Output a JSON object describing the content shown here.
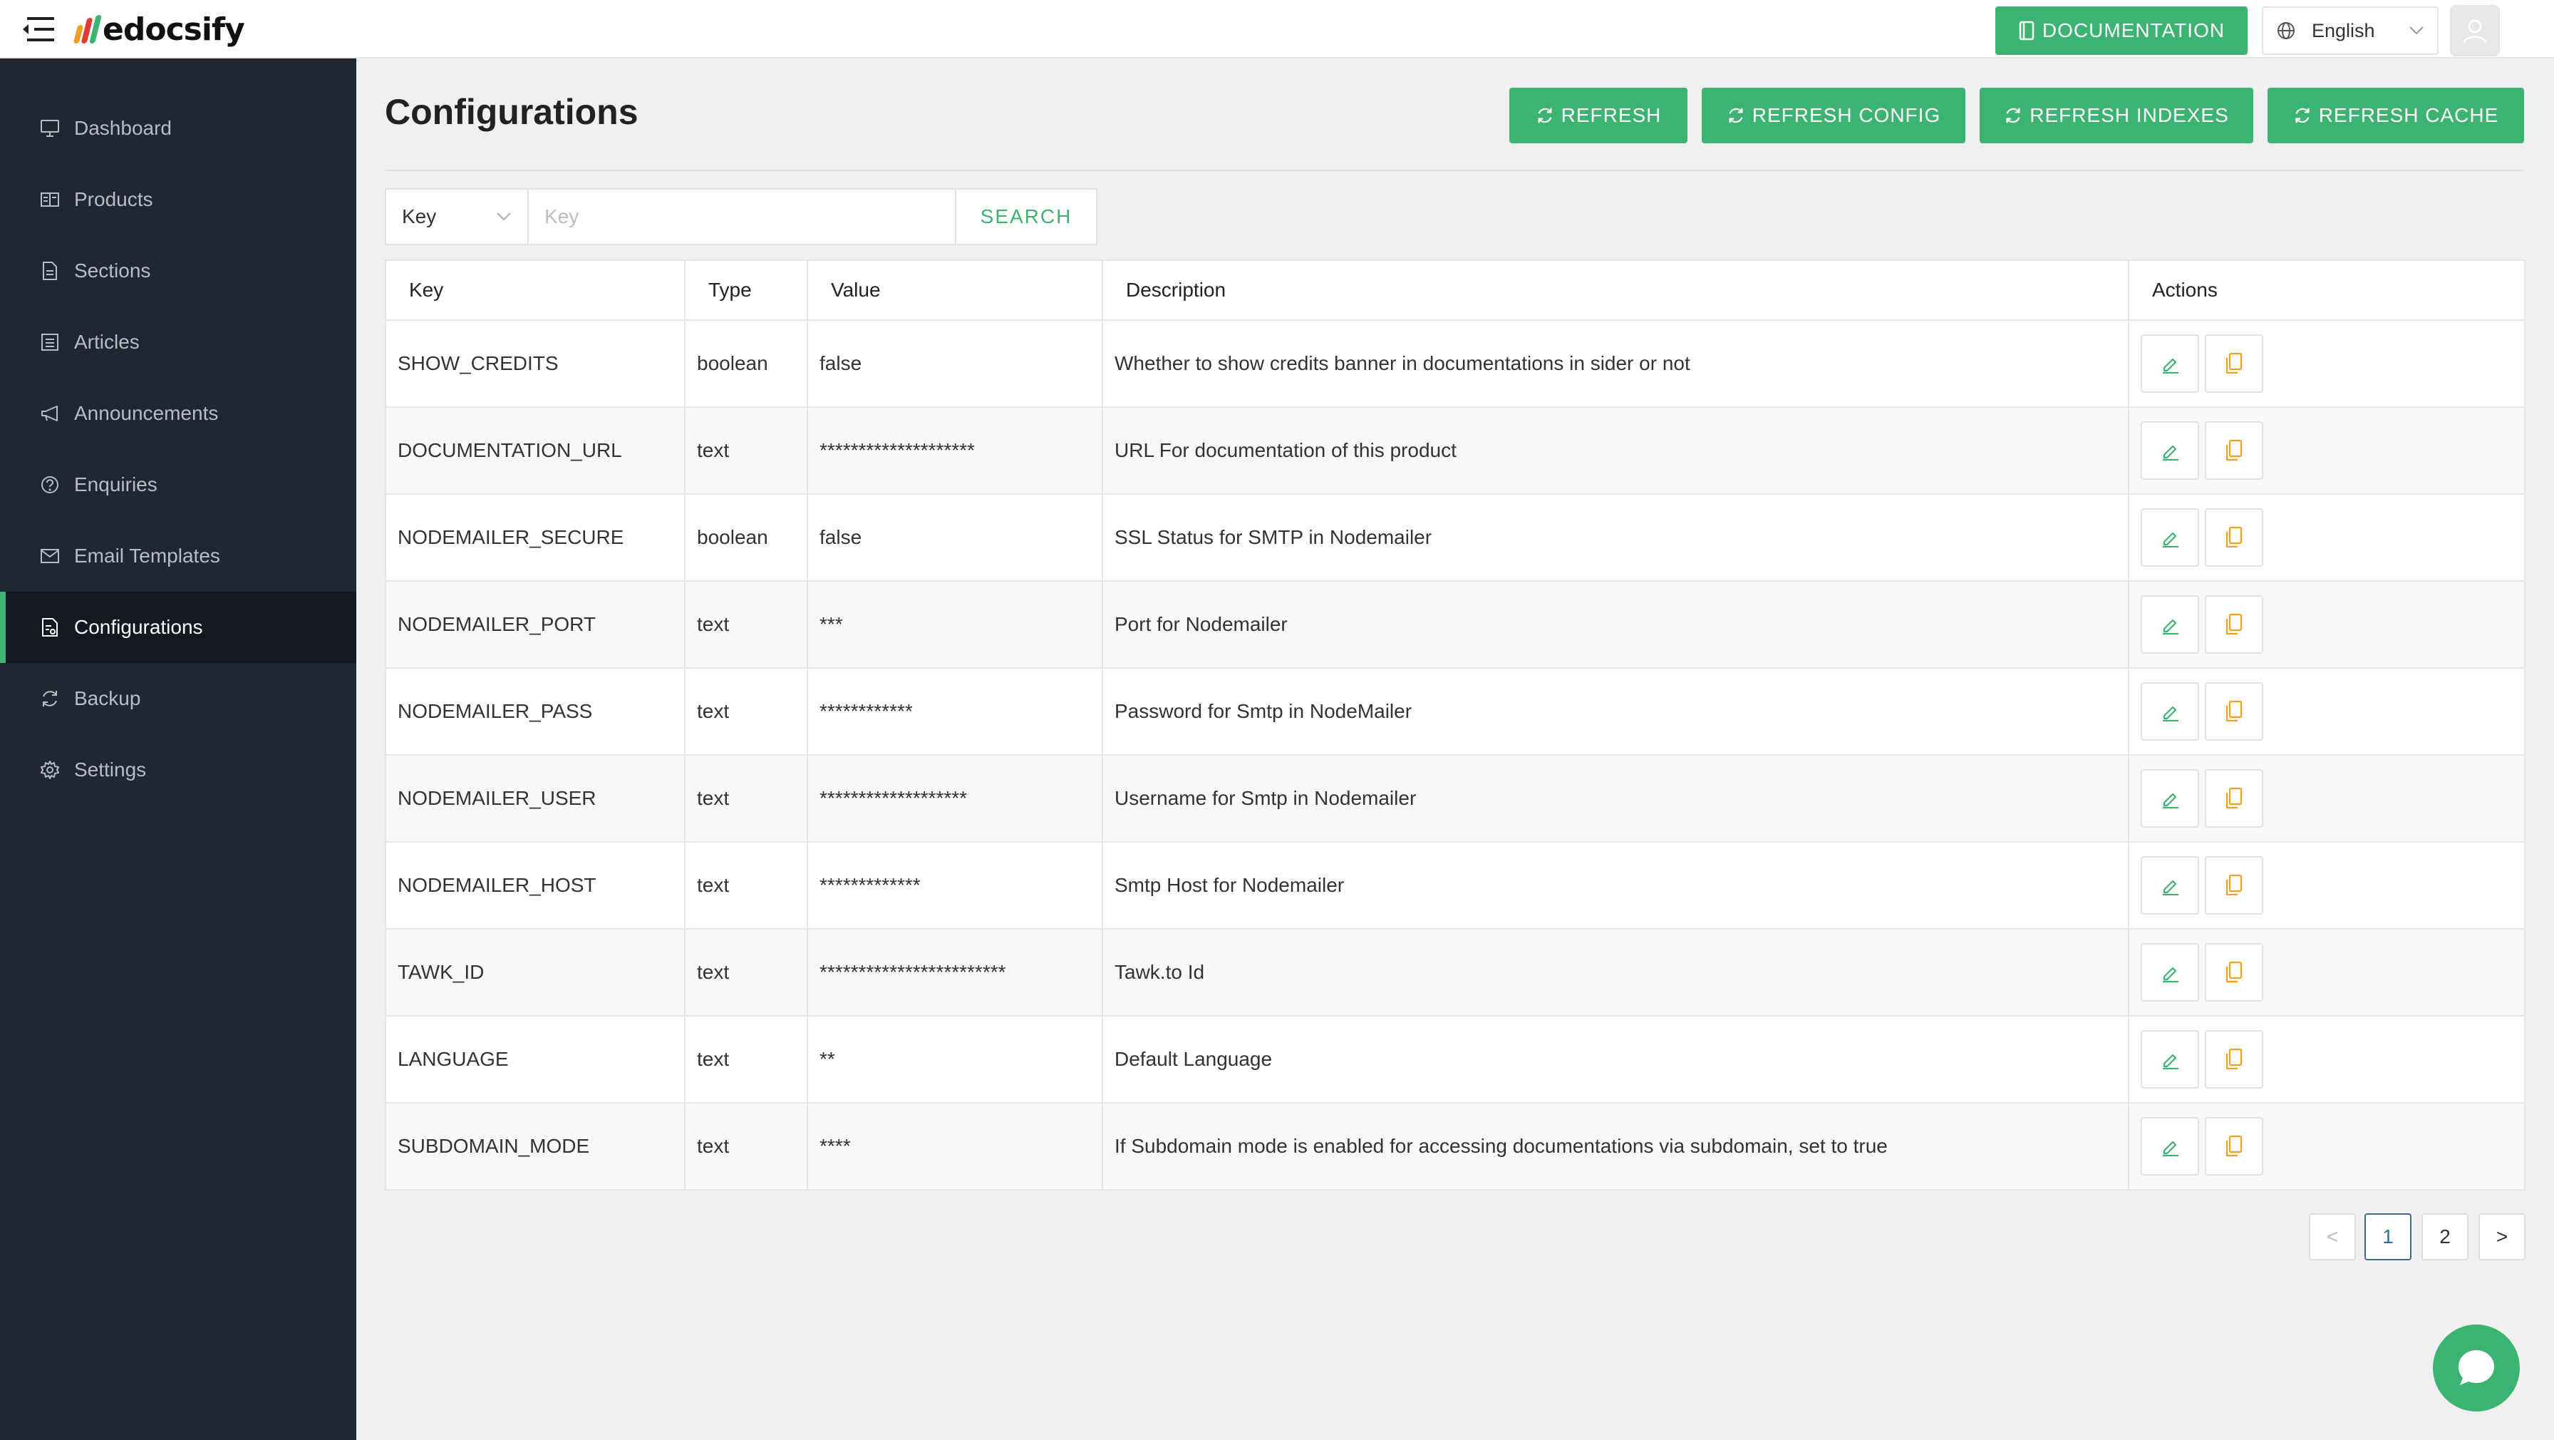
{
  "app": {
    "logo_text": "edocsify",
    "documentation_label": "DOCUMENTATION",
    "language": "English"
  },
  "sidebar": {
    "items": [
      {
        "label": "Dashboard",
        "icon": "monitor-icon"
      },
      {
        "label": "Products",
        "icon": "products-icon"
      },
      {
        "label": "Sections",
        "icon": "file-icon"
      },
      {
        "label": "Articles",
        "icon": "list-icon"
      },
      {
        "label": "Announcements",
        "icon": "megaphone-icon"
      },
      {
        "label": "Enquiries",
        "icon": "question-icon"
      },
      {
        "label": "Email Templates",
        "icon": "mail-icon"
      },
      {
        "label": "Configurations",
        "icon": "config-icon",
        "active": true
      },
      {
        "label": "Backup",
        "icon": "sync-icon"
      },
      {
        "label": "Settings",
        "icon": "gear-icon"
      }
    ]
  },
  "main": {
    "title": "Configurations",
    "actions": [
      "REFRESH",
      "REFRESH CONFIG",
      "REFRESH INDEXES",
      "REFRESH CACHE"
    ],
    "search": {
      "field": "Key",
      "placeholder": "Key",
      "value": "",
      "button": "SEARCH"
    },
    "table": {
      "columns": [
        "Key",
        "Type",
        "Value",
        "Description",
        "Actions"
      ],
      "rows": [
        {
          "key": "SHOW_CREDITS",
          "type": "boolean",
          "value": "false",
          "description": "Whether to show credits banner in documentations in sider or not"
        },
        {
          "key": "DOCUMENTATION_URL",
          "type": "text",
          "value": "********************",
          "description": "URL For documentation of this product"
        },
        {
          "key": "NODEMAILER_SECURE",
          "type": "boolean",
          "value": "false",
          "description": "SSL Status for SMTP in Nodemailer"
        },
        {
          "key": "NODEMAILER_PORT",
          "type": "text",
          "value": "***",
          "description": "Port for Nodemailer"
        },
        {
          "key": "NODEMAILER_PASS",
          "type": "text",
          "value": "************",
          "description": "Password for Smtp in NodeMailer"
        },
        {
          "key": "NODEMAILER_USER",
          "type": "text",
          "value": "*******************",
          "description": "Username for Smtp in Nodemailer"
        },
        {
          "key": "NODEMAILER_HOST",
          "type": "text",
          "value": "*************",
          "description": "Smtp Host for Nodemailer"
        },
        {
          "key": "TAWK_ID",
          "type": "text",
          "value": "************************",
          "description": "Tawk.to Id"
        },
        {
          "key": "LANGUAGE",
          "type": "text",
          "value": "**",
          "description": "Default Language"
        },
        {
          "key": "SUBDOMAIN_MODE",
          "type": "text",
          "value": "****",
          "description": "If Subdomain mode is enabled for accessing documentations via subdomain, set to true"
        }
      ]
    },
    "pagination": {
      "prev": "<",
      "pages": [
        "1",
        "2"
      ],
      "current": "1",
      "next": ">"
    }
  },
  "colors": {
    "accent": "#3cb371",
    "sidebar_bg": "#202632",
    "sidebar_active_bg": "#141821",
    "delete_icon": "#f0a020",
    "page_bg": "#f0f0f0"
  }
}
